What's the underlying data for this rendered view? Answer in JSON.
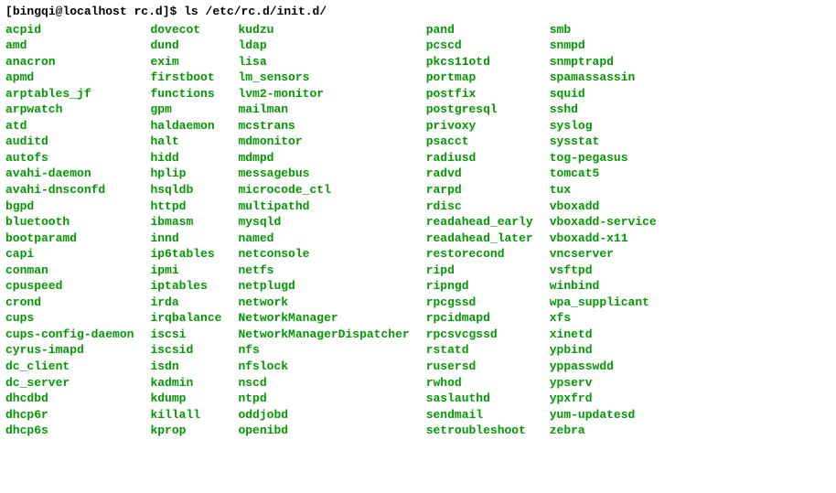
{
  "prompt": {
    "user": "bingqi",
    "host": "localhost",
    "dir": "rc.d",
    "sign": "$",
    "command": "ls /etc/rc.d/init.d/"
  },
  "columns": [
    [
      "acpid",
      "amd",
      "anacron",
      "apmd",
      "arptables_jf",
      "arpwatch",
      "atd",
      "auditd",
      "autofs",
      "avahi-daemon",
      "avahi-dnsconfd",
      "bgpd",
      "bluetooth",
      "bootparamd",
      "capi",
      "conman",
      "cpuspeed",
      "crond",
      "cups",
      "cups-config-daemon",
      "cyrus-imapd",
      "dc_client",
      "dc_server",
      "dhcdbd",
      "dhcp6r",
      "dhcp6s"
    ],
    [
      "dovecot",
      "dund",
      "exim",
      "firstboot",
      "functions",
      "gpm",
      "haldaemon",
      "halt",
      "hidd",
      "hplip",
      "hsqldb",
      "httpd",
      "ibmasm",
      "innd",
      "ip6tables",
      "ipmi",
      "iptables",
      "irda",
      "irqbalance",
      "iscsi",
      "iscsid",
      "isdn",
      "kadmin",
      "kdump",
      "killall",
      "kprop"
    ],
    [
      "kudzu",
      "ldap",
      "lisa",
      "lm_sensors",
      "lvm2-monitor",
      "mailman",
      "mcstrans",
      "mdmonitor",
      "mdmpd",
      "messagebus",
      "microcode_ctl",
      "multipathd",
      "mysqld",
      "named",
      "netconsole",
      "netfs",
      "netplugd",
      "network",
      "NetworkManager",
      "NetworkManagerDispatcher",
      "nfs",
      "nfslock",
      "nscd",
      "ntpd",
      "oddjobd",
      "openibd"
    ],
    [
      "pand",
      "pcscd",
      "pkcs11otd",
      "portmap",
      "postfix",
      "postgresql",
      "privoxy",
      "psacct",
      "radiusd",
      "radvd",
      "rarpd",
      "rdisc",
      "readahead_early",
      "readahead_later",
      "restorecond",
      "ripd",
      "ripngd",
      "rpcgssd",
      "rpcidmapd",
      "rpcsvcgssd",
      "rstatd",
      "rusersd",
      "rwhod",
      "saslauthd",
      "sendmail",
      "setroubleshoot"
    ],
    [
      "smb",
      "snmpd",
      "snmptrapd",
      "spamassassin",
      "squid",
      "sshd",
      "syslog",
      "sysstat",
      "tog-pegasus",
      "tomcat5",
      "tux",
      "vboxadd",
      "vboxadd-service",
      "vboxadd-x11",
      "vncserver",
      "vsftpd",
      "winbind",
      "wpa_supplicant",
      "xfs",
      "xinetd",
      "ypbind",
      "yppasswdd",
      "ypserv",
      "ypxfrd",
      "yum-updatesd",
      "zebra"
    ]
  ]
}
